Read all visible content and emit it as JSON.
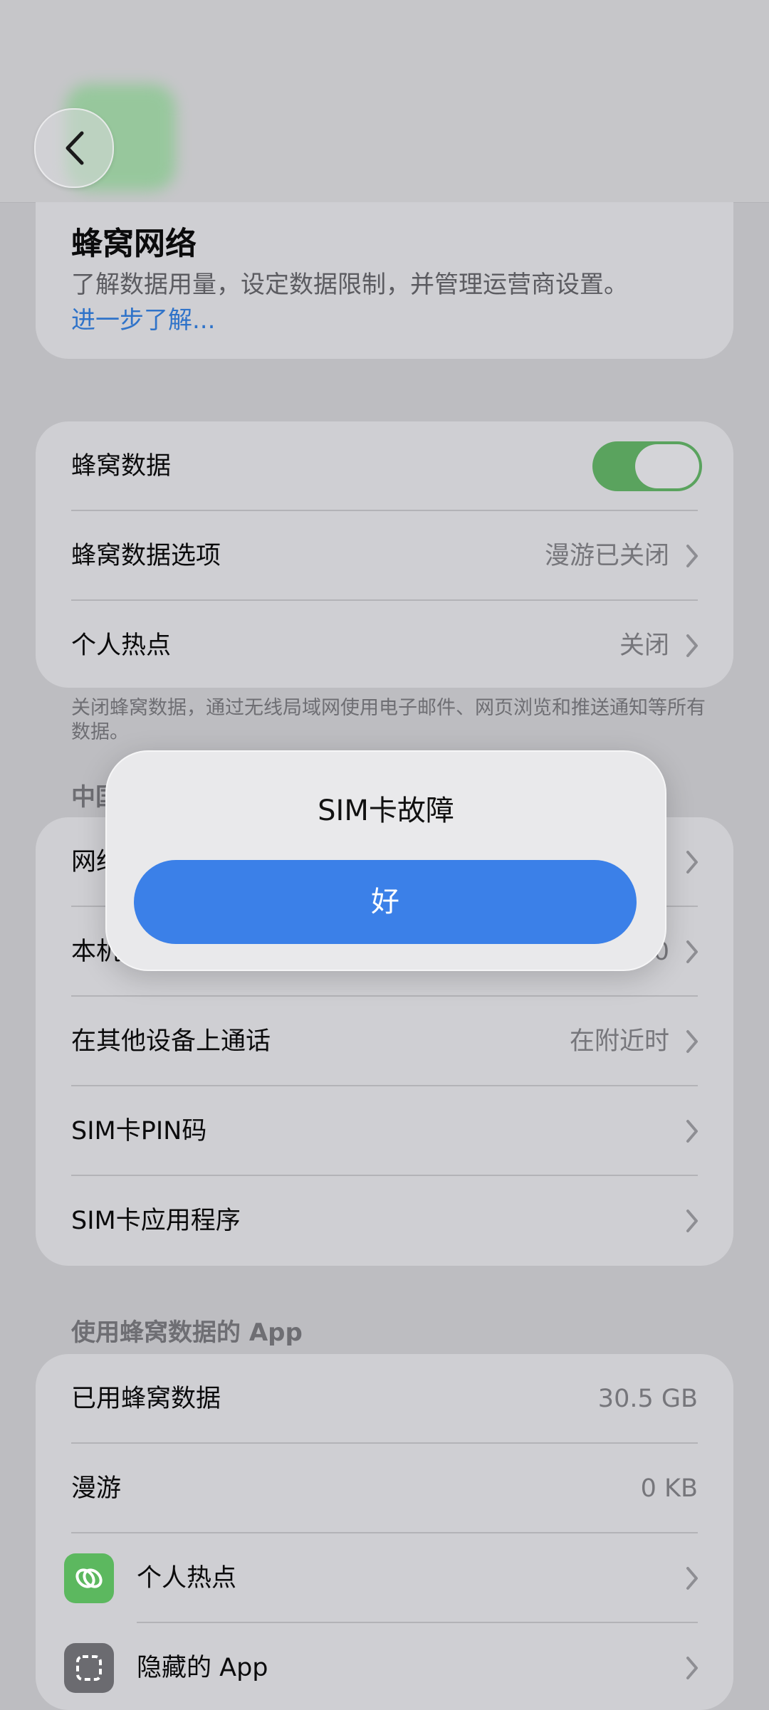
{
  "info": {
    "title": "蜂窝网络",
    "description": "了解数据用量，设定数据限制，并管理运营商设置。",
    "link": "进一步了解..."
  },
  "settings": {
    "cellular_data": {
      "label": "蜂窝数据",
      "enabled": true
    },
    "cellular_options": {
      "label": "蜂窝数据选项",
      "value": "漫游已关闭"
    },
    "hotspot": {
      "label": "个人热点",
      "value": "关闭"
    },
    "footnote": "关闭蜂窝数据，通过无线局域网使用电子邮件、网页浏览和推送通知等所有数据。"
  },
  "carrier": {
    "header": "中国",
    "rows": [
      {
        "label": "网络",
        "value": ""
      },
      {
        "label": "本机",
        "value": "20"
      },
      {
        "label": "在其他设备上通话",
        "value": "在附近时"
      },
      {
        "label": "SIM卡PIN码",
        "value": ""
      },
      {
        "label": "SIM卡应用程序",
        "value": ""
      }
    ]
  },
  "apps": {
    "header": "使用蜂窝数据的 App",
    "used": {
      "label": "已用蜂窝数据",
      "value": "30.5 GB"
    },
    "roaming": {
      "label": "漫游",
      "value": "0 KB"
    },
    "hotspot": {
      "label": "个人热点",
      "icon": "link-icon",
      "color": "#5cb85f"
    },
    "hidden": {
      "label": "隐藏的 App",
      "icon": "hidden-apps-icon",
      "color": "#6b6b70"
    }
  },
  "dialog": {
    "title": "SIM卡故障",
    "button": "好",
    "button_color": "#3b80e8"
  }
}
